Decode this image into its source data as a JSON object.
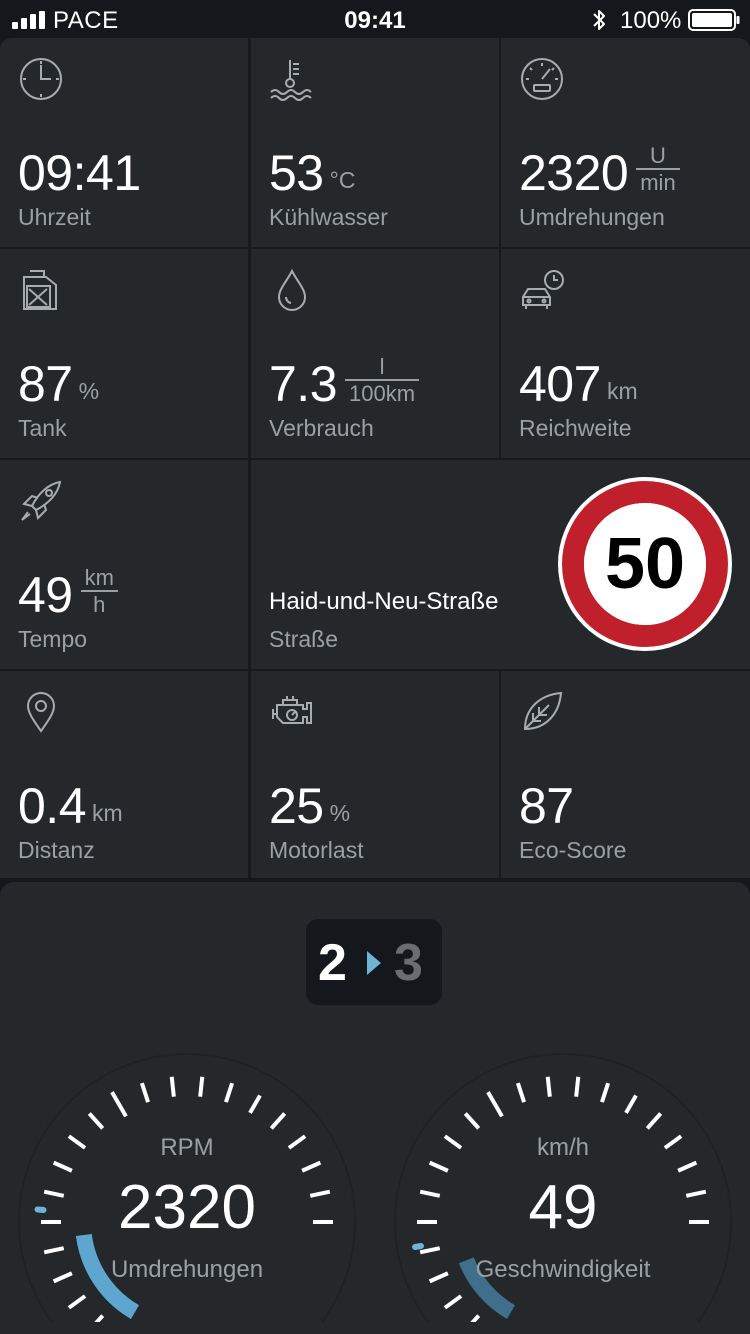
{
  "status_bar": {
    "carrier": "PACE",
    "time": "09:41",
    "battery": "100%"
  },
  "tiles": {
    "uhrzeit": {
      "value": "09:41",
      "label": "Uhrzeit",
      "icon": "clock-icon"
    },
    "kuehlwasser": {
      "value": "53",
      "unit": "°C",
      "label": "Kühlwasser",
      "icon": "coolant-temperature-icon"
    },
    "umdrehungen": {
      "value": "2320",
      "unit_num": "U",
      "unit_den": "min",
      "label": "Umdrehungen",
      "icon": "tachometer-icon"
    },
    "tank": {
      "value": "87",
      "unit": "%",
      "label": "Tank",
      "icon": "fuel-canister-icon"
    },
    "verbrauch": {
      "value": "7.3",
      "unit_num": "l",
      "unit_den": "100km",
      "label": "Verbrauch",
      "icon": "fuel-drop-icon"
    },
    "reichweite": {
      "value": "407",
      "unit": "km",
      "label": "Reichweite",
      "icon": "car-clock-icon"
    },
    "tempo": {
      "value": "49",
      "unit_num": "km",
      "unit_den": "h",
      "label": "Tempo",
      "icon": "rocket-icon"
    },
    "strasse": {
      "value": "Haid-und-Neu-Straße",
      "label": "Straße",
      "speed_limit": "50"
    },
    "distanz": {
      "value": "0.4",
      "unit": "km",
      "label": "Distanz",
      "icon": "location-pin-icon"
    },
    "motorlast": {
      "value": "25",
      "unit": "%",
      "label": "Motorlast",
      "icon": "engine-icon"
    },
    "eco": {
      "value": "87",
      "label": "Eco-Score",
      "icon": "leaf-icon"
    }
  },
  "gear": {
    "current": "2",
    "next": "3"
  },
  "gauges": {
    "rpm": {
      "unit": "RPM",
      "value": "2320",
      "label": "Umdrehungen",
      "fill": 0.22
    },
    "speed": {
      "unit": "km/h",
      "value": "49",
      "label": "Geschwindigkeit",
      "fill": 0.16
    }
  },
  "colors": {
    "background": "#14171b",
    "tile": "#25282b",
    "accent": "#6fb3d6",
    "sign_red": "#c0202c",
    "muted": "#9aa0a6"
  }
}
